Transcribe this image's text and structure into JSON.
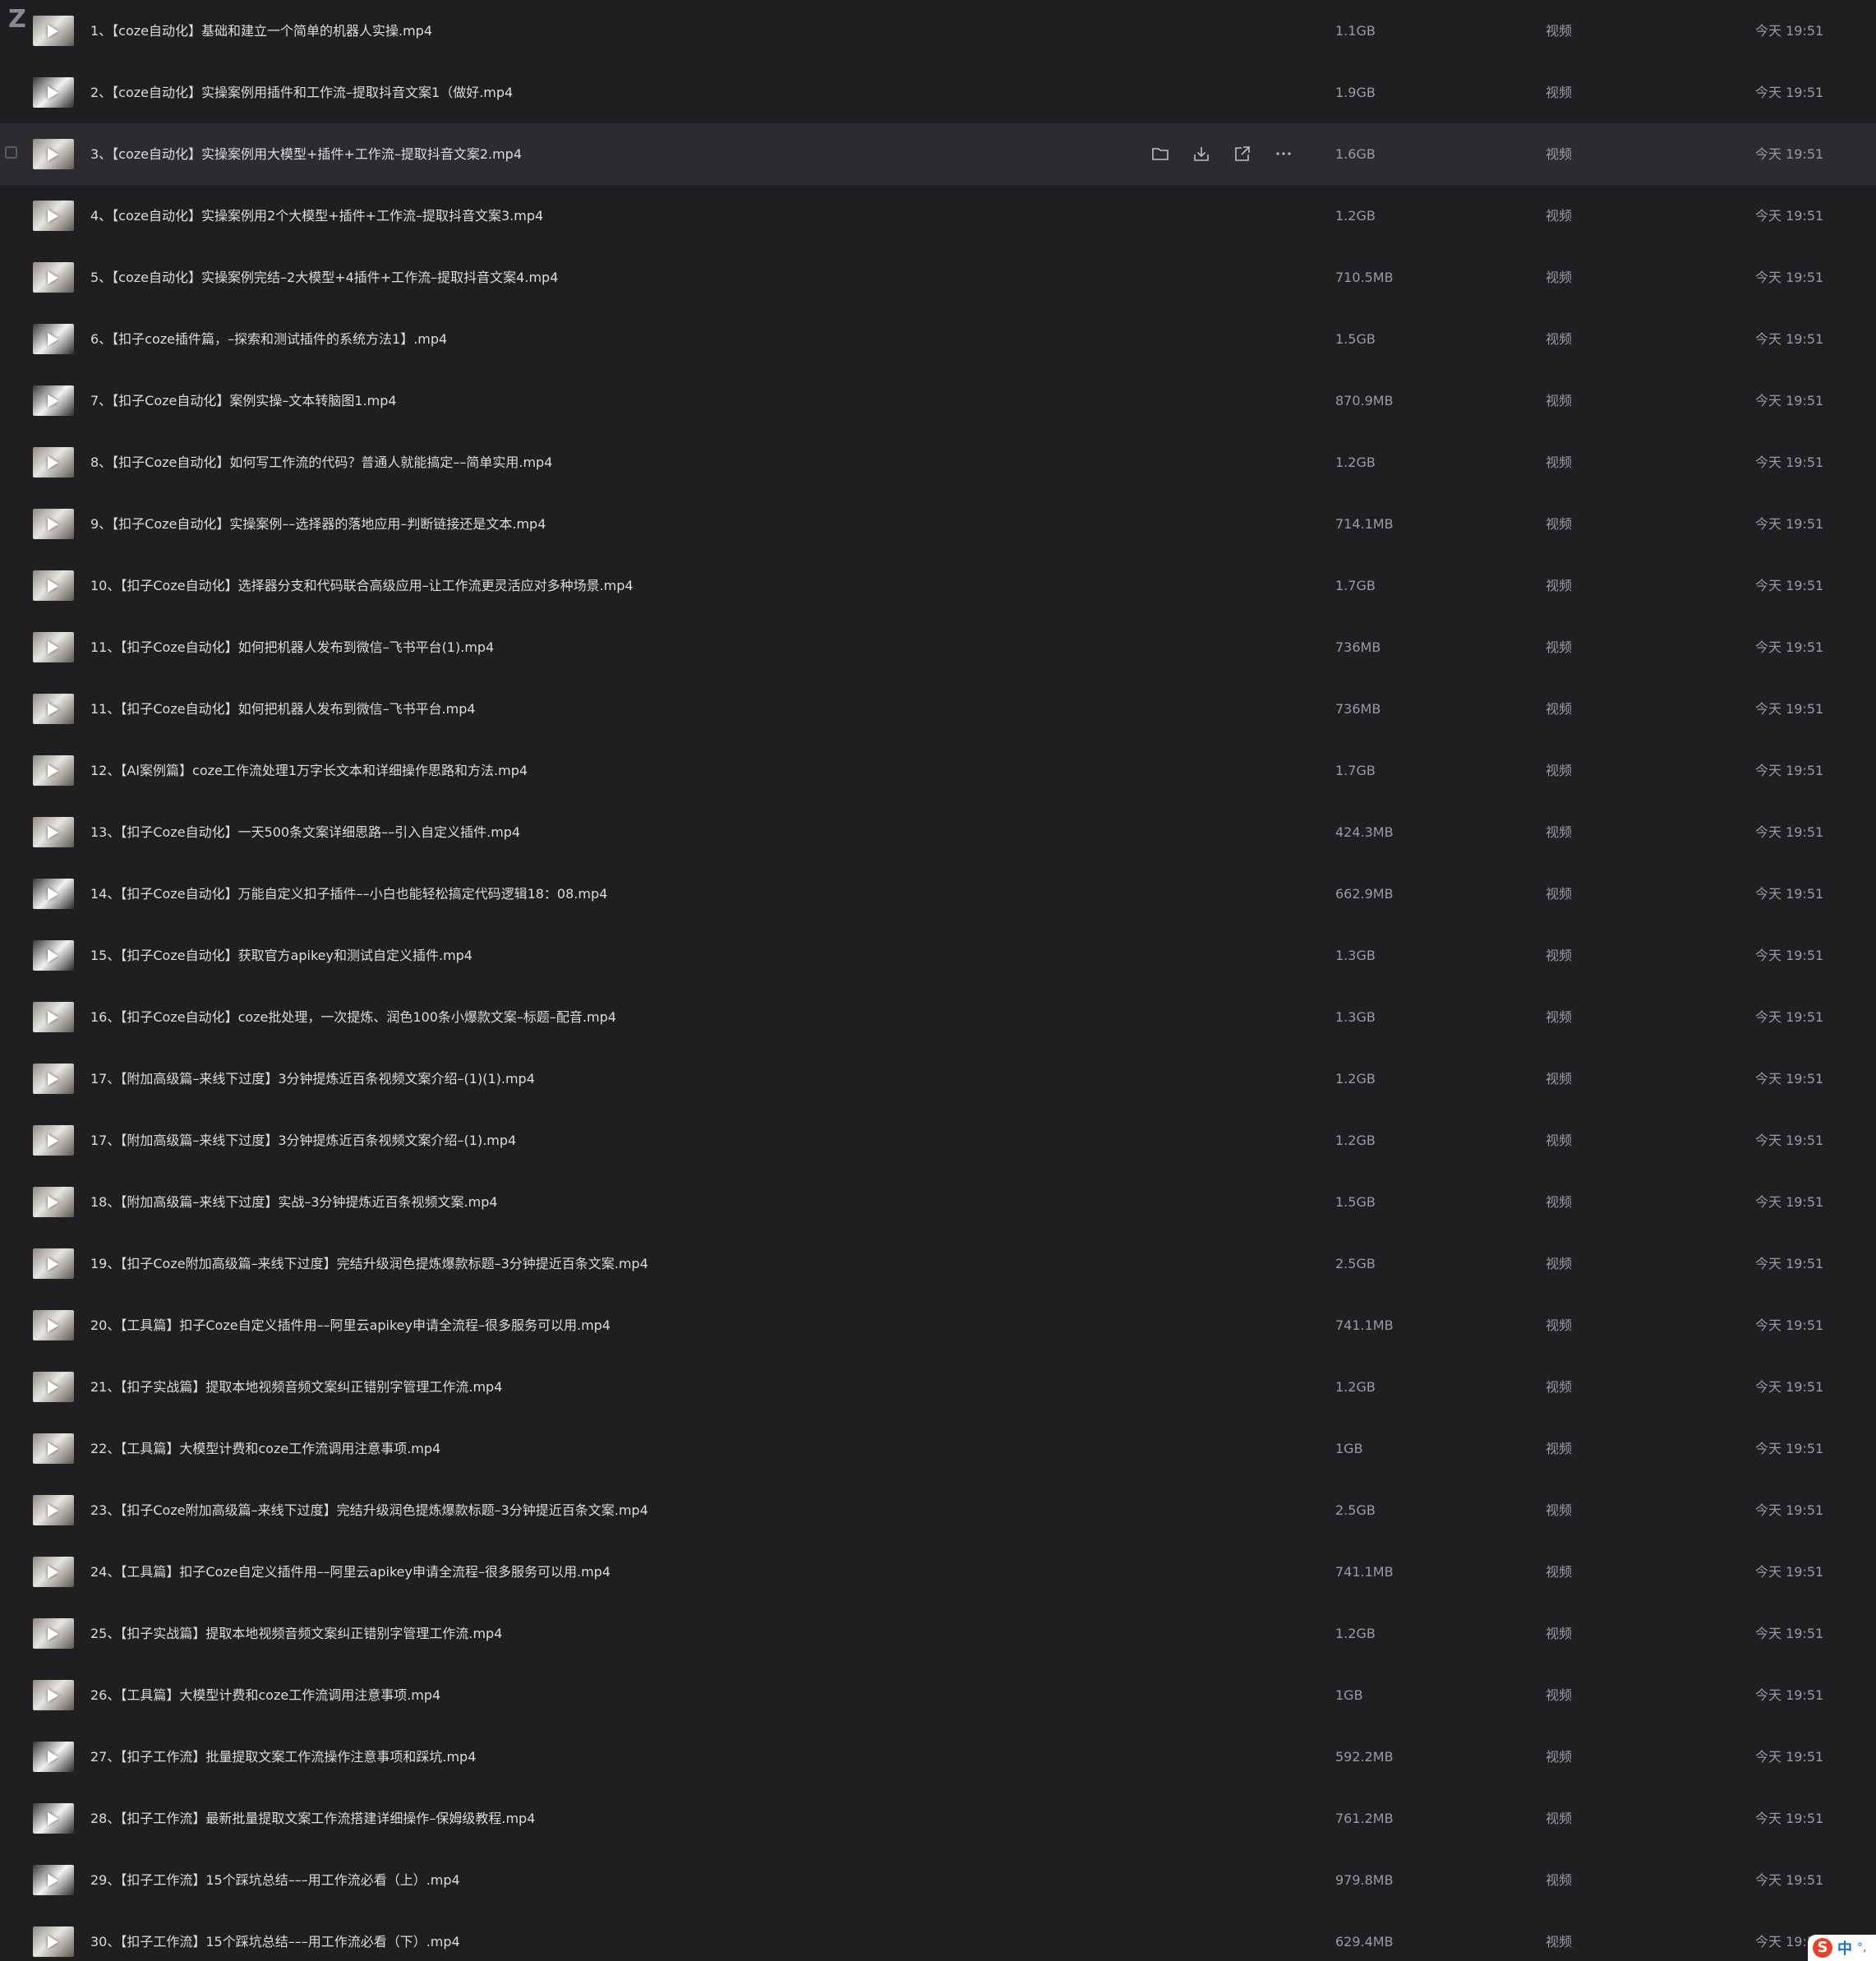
{
  "logo": "Z",
  "hover_row_index": 2,
  "actions": [
    {
      "name": "folder-icon",
      "label": "folder"
    },
    {
      "name": "download-icon",
      "label": "download"
    },
    {
      "name": "share-icon",
      "label": "share"
    },
    {
      "name": "more-icon",
      "label": "more"
    }
  ],
  "files": [
    {
      "name": "1、【coze自动化】基础和建立一个简单的机器人实操.mp4",
      "size": "1.1GB",
      "type": "视频",
      "time": "今天 19:51"
    },
    {
      "name": "2、【coze自动化】实操案例用插件和工作流–提取抖音文案1（做好.mp4",
      "size": "1.9GB",
      "type": "视频",
      "time": "今天 19:51"
    },
    {
      "name": "3、【coze自动化】实操案例用大模型+插件+工作流–提取抖音文案2.mp4",
      "size": "1.6GB",
      "type": "视频",
      "time": "今天 19:51"
    },
    {
      "name": "4、【coze自动化】实操案例用2个大模型+插件+工作流–提取抖音文案3.mp4",
      "size": "1.2GB",
      "type": "视频",
      "time": "今天 19:51"
    },
    {
      "name": "5、【coze自动化】实操案例完结–2大模型+4插件+工作流–提取抖音文案4.mp4",
      "size": "710.5MB",
      "type": "视频",
      "time": "今天 19:51"
    },
    {
      "name": "6、【扣子coze插件篇，–探索和测试插件的系统方法1】.mp4",
      "size": "1.5GB",
      "type": "视频",
      "time": "今天 19:51"
    },
    {
      "name": "7、【扣子Coze自动化】案例实操–文本转脑图1.mp4",
      "size": "870.9MB",
      "type": "视频",
      "time": "今天 19:51"
    },
    {
      "name": "8、【扣子Coze自动化】如何写工作流的代码？普通人就能搞定––简单实用.mp4",
      "size": "1.2GB",
      "type": "视频",
      "time": "今天 19:51"
    },
    {
      "name": "9、【扣子Coze自动化】实操案例––选择器的落地应用–判断链接还是文本.mp4",
      "size": "714.1MB",
      "type": "视频",
      "time": "今天 19:51"
    },
    {
      "name": "10、【扣子Coze自动化】选择器分支和代码联合高级应用–让工作流更灵活应对多种场景.mp4",
      "size": "1.7GB",
      "type": "视频",
      "time": "今天 19:51"
    },
    {
      "name": "11、【扣子Coze自动化】如何把机器人发布到微信–飞书平台(1).mp4",
      "size": "736MB",
      "type": "视频",
      "time": "今天 19:51"
    },
    {
      "name": "11、【扣子Coze自动化】如何把机器人发布到微信–飞书平台.mp4",
      "size": "736MB",
      "type": "视频",
      "time": "今天 19:51"
    },
    {
      "name": "12、【AI案例篇】coze工作流处理1万字长文本和详细操作思路和方法.mp4",
      "size": "1.7GB",
      "type": "视频",
      "time": "今天 19:51"
    },
    {
      "name": "13、【扣子Coze自动化】一天500条文案详细思路––引入自定义插件.mp4",
      "size": "424.3MB",
      "type": "视频",
      "time": "今天 19:51"
    },
    {
      "name": "14、【扣子Coze自动化】万能自定义扣子插件––小白也能轻松搞定代码逻辑18：08.mp4",
      "size": "662.9MB",
      "type": "视频",
      "time": "今天 19:51"
    },
    {
      "name": "15、【扣子Coze自动化】获取官方apikey和测试自定义插件.mp4",
      "size": "1.3GB",
      "type": "视频",
      "time": "今天 19:51"
    },
    {
      "name": "16、【扣子Coze自动化】coze批处理，一次提炼、润色100条小爆款文案–标题–配音.mp4",
      "size": "1.3GB",
      "type": "视频",
      "time": "今天 19:51"
    },
    {
      "name": "17、【附加高级篇–来线下过度】3分钟提炼近百条视频文案介绍–(1)(1).mp4",
      "size": "1.2GB",
      "type": "视频",
      "time": "今天 19:51"
    },
    {
      "name": "17、【附加高级篇–来线下过度】3分钟提炼近百条视频文案介绍–(1).mp4",
      "size": "1.2GB",
      "type": "视频",
      "time": "今天 19:51"
    },
    {
      "name": "18、【附加高级篇–来线下过度】实战–3分钟提炼近百条视频文案.mp4",
      "size": "1.5GB",
      "type": "视频",
      "time": "今天 19:51"
    },
    {
      "name": "19、【扣子Coze附加高级篇–来线下过度】完结升级润色提炼爆款标题–3分钟提近百条文案.mp4",
      "size": "2.5GB",
      "type": "视频",
      "time": "今天 19:51"
    },
    {
      "name": "20、【工具篇】扣子Coze自定义插件用––阿里云apikey申请全流程–很多服务可以用.mp4",
      "size": "741.1MB",
      "type": "视频",
      "time": "今天 19:51"
    },
    {
      "name": "21、【扣子实战篇】提取本地视频音频文案纠正错别字管理工作流.mp4",
      "size": "1.2GB",
      "type": "视频",
      "time": "今天 19:51"
    },
    {
      "name": "22、【工具篇】大模型计费和coze工作流调用注意事项.mp4",
      "size": "1GB",
      "type": "视频",
      "time": "今天 19:51"
    },
    {
      "name": "23、【扣子Coze附加高级篇–来线下过度】完结升级润色提炼爆款标题–3分钟提近百条文案.mp4",
      "size": "2.5GB",
      "type": "视频",
      "time": "今天 19:51"
    },
    {
      "name": "24、【工具篇】扣子Coze自定义插件用––阿里云apikey申请全流程–很多服务可以用.mp4",
      "size": "741.1MB",
      "type": "视频",
      "time": "今天 19:51"
    },
    {
      "name": "25、【扣子实战篇】提取本地视频音频文案纠正错别字管理工作流.mp4",
      "size": "1.2GB",
      "type": "视频",
      "time": "今天 19:51"
    },
    {
      "name": "26、【工具篇】大模型计费和coze工作流调用注意事项.mp4",
      "size": "1GB",
      "type": "视频",
      "time": "今天 19:51"
    },
    {
      "name": "27、【扣子工作流】批量提取文案工作流操作注意事项和踩坑.mp4",
      "size": "592.2MB",
      "type": "视频",
      "time": "今天 19:51"
    },
    {
      "name": "28、【扣子工作流】最新批量提取文案工作流搭建详细操作–保姆级教程.mp4",
      "size": "761.2MB",
      "type": "视频",
      "time": "今天 19:51"
    },
    {
      "name": "29、【扣子工作流】15个踩坑总结–––用工作流必看（上）.mp4",
      "size": "979.8MB",
      "type": "视频",
      "time": "今天 19:51"
    },
    {
      "name": "30、【扣子工作流】15个踩坑总结–––用工作流必看（下）.mp4",
      "size": "629.4MB",
      "type": "视频",
      "time": "今天 19:51"
    }
  ],
  "ime": {
    "logo": "S",
    "mode": "中",
    "punct": "°,"
  },
  "colors": {
    "background": "#1f1f22",
    "hover_row": "#2c2c30",
    "text": "#dcdcde",
    "meta_text": "#9a9aa0",
    "ime_accent": "#1e6fd9"
  }
}
